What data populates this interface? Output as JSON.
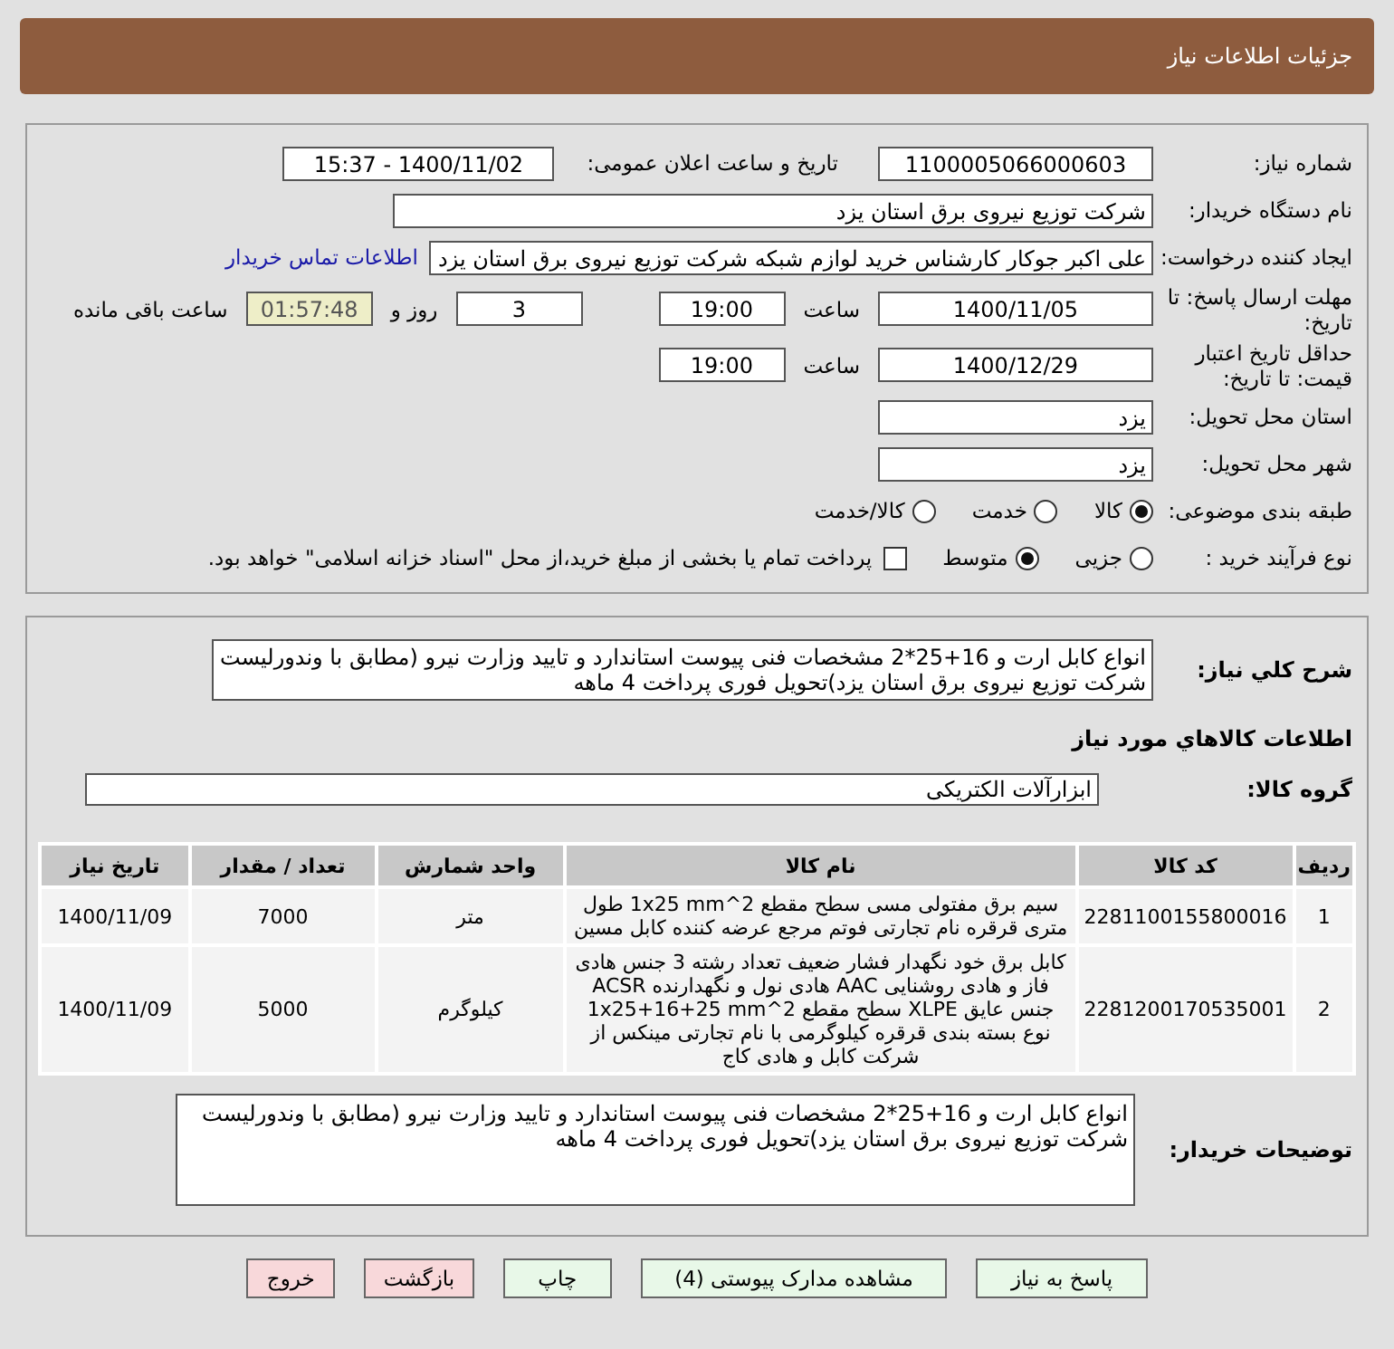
{
  "header": {
    "title": "جزئیات اطلاعات نیاز"
  },
  "form": {
    "need_number": {
      "label": "شماره نیاز:",
      "value": "1100005066000603"
    },
    "announce": {
      "label": "تاریخ و ساعت اعلان عمومی:",
      "value": "1400/11/02 - 15:37"
    },
    "buyer_org": {
      "label": "نام دستگاه خریدار:",
      "value": "شرکت توزیع نیروی برق استان یزد"
    },
    "requester": {
      "label": "ایجاد کننده درخواست:",
      "value": "علی اکبر  جوکار  کارشناس خرید لوازم شبکه  شرکت توزیع نیروی برق استان یزد",
      "link": "اطلاعات تماس خریدار"
    },
    "deadline": {
      "label": "مهلت ارسال پاسخ: تا تاریخ:",
      "date": "1400/11/05",
      "time_label": "ساعت",
      "time": "19:00",
      "days": "3",
      "days_label": "روز و",
      "remaining": "01:57:48",
      "remaining_label": "ساعت باقی مانده"
    },
    "validity": {
      "label": "حداقل تاریخ اعتبار قیمت: تا تاریخ:",
      "date": "1400/12/29",
      "time_label": "ساعت",
      "time": "19:00"
    },
    "province": {
      "label": "استان محل تحویل:",
      "value": "یزد"
    },
    "city": {
      "label": "شهر محل تحویل:",
      "value": "یزد"
    },
    "category": {
      "label": "طبقه بندی موضوعی:",
      "options": [
        {
          "label": "کالا",
          "selected": true
        },
        {
          "label": "خدمت",
          "selected": false
        },
        {
          "label": "کالا/خدمت",
          "selected": false
        }
      ]
    },
    "process": {
      "label": "نوع فرآیند خرید :",
      "options": [
        {
          "label": "جزیی",
          "selected": false
        },
        {
          "label": "متوسط",
          "selected": true
        }
      ],
      "payment": {
        "label": "پرداخت تمام یا بخشی از مبلغ خرید،از محل \"اسناد خزانه اسلامی\" خواهد بود.",
        "checked": false
      }
    }
  },
  "summary": {
    "label": "شرح کلي نياز:",
    "text": "انواع کابل ارت و 16+25*2 مشخصات فنی پیوست استاندارد و تایید وزارت نیرو (مطابق با وندورلیست شرکت توزیع نیروی برق استان یزد)تحویل فوری پرداخت 4 ماهه"
  },
  "goods": {
    "title": "اطلاعات کالاهاي مورد نياز",
    "group": {
      "label": "گروه کالا:",
      "value": "ابزارآلات الکتریکی"
    },
    "columns": [
      "ردیف",
      "کد کالا",
      "نام کالا",
      "واحد شمارش",
      "تعداد / مقدار",
      "تاریخ نیاز"
    ],
    "rows": [
      [
        "1",
        "2281100155800016",
        "سیم برق مفتولی مسی سطح مقطع 2^1x25 mm طول متری قرقره نام تجارتی فوتم مرجع عرضه کننده کابل مسین",
        "متر",
        "7000",
        "1400/11/09"
      ],
      [
        "2",
        "2281200170535001",
        "کابل برق خود نگهدار فشار ضعیف تعداد رشته 3 جنس هادی فاز و هادی روشنایی AAC هادی نول و نگهدارنده ACSR جنس عایق XLPE سطح مقطع 2^1x25+16+25 mm نوع بسته بندی قرقره کیلوگرمی با نام تجارتی مینکس از شرکت کابل و هادی کاج",
        "کیلوگرم",
        "5000",
        "1400/11/09"
      ]
    ]
  },
  "buyer_notes": {
    "label": "توضیحات خریدار:",
    "text": "انواع کابل ارت و 16+25*2 مشخصات فنی پیوست استاندارد و تایید وزارت نیرو (مطابق با وندورلیست شرکت توزیع نیروی برق استان یزد)تحویل فوری پرداخت 4 ماهه"
  },
  "buttons": [
    {
      "label": "پاسخ به نیاز",
      "kind": "normal"
    },
    {
      "label": "مشاهده مدارک پیوستی (4)",
      "kind": "normal"
    },
    {
      "label": "چاپ",
      "kind": "normal"
    },
    {
      "label": "بازگشت",
      "kind": "danger"
    },
    {
      "label": "خروج",
      "kind": "danger"
    }
  ]
}
